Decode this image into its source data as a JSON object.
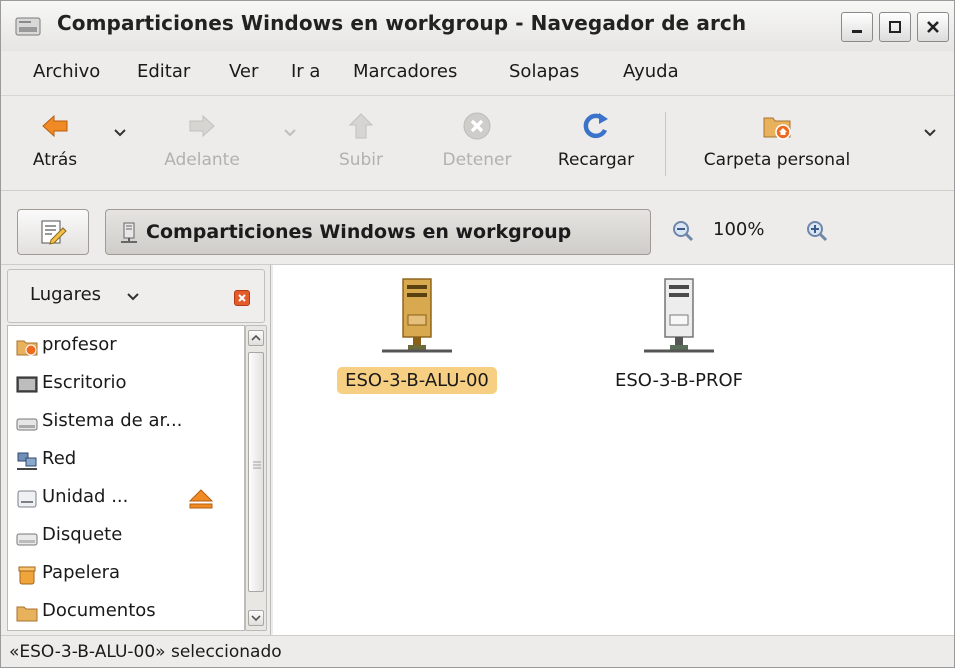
{
  "window": {
    "title": "Comparticiones Windows en workgroup - Navegador de arch"
  },
  "menubar": {
    "items": [
      "Archivo",
      "Editar",
      "Ver",
      "Ir a",
      "Marcadores",
      "Solapas",
      "Ayuda"
    ]
  },
  "toolbar": {
    "back": "Atrás",
    "forward": "Adelante",
    "up": "Subir",
    "stop": "Detener",
    "reload": "Recargar",
    "home": "Carpeta personal"
  },
  "location": {
    "path": "Comparticiones Windows en workgroup",
    "zoom": "100%"
  },
  "sidebar": {
    "selector": "Lugares",
    "places": [
      {
        "label": "profesor",
        "icon": "home-folder-icon"
      },
      {
        "label": "Escritorio",
        "icon": "desktop-icon"
      },
      {
        "label": "Sistema de ar...",
        "icon": "filesystem-icon"
      },
      {
        "label": "Red",
        "icon": "network-icon"
      },
      {
        "label": "Unidad ...",
        "icon": "drive-icon"
      },
      {
        "label": "Disquete",
        "icon": "floppy-icon"
      },
      {
        "label": "Papelera",
        "icon": "trash-icon"
      },
      {
        "label": "Documentos",
        "icon": "folder-icon"
      }
    ]
  },
  "files": [
    {
      "label": "ESO-3-B-ALU-00",
      "icon": "network-server-icon",
      "selected": true
    },
    {
      "label": "ESO-3-B-PROF",
      "icon": "network-server-icon",
      "selected": false
    }
  ],
  "status": {
    "text": "«ESO-3-B-ALU-00» seleccionado"
  },
  "colors": {
    "selection": "#f6cf82",
    "back_arrow": "#f08a24",
    "reload": "#3a73c9"
  }
}
